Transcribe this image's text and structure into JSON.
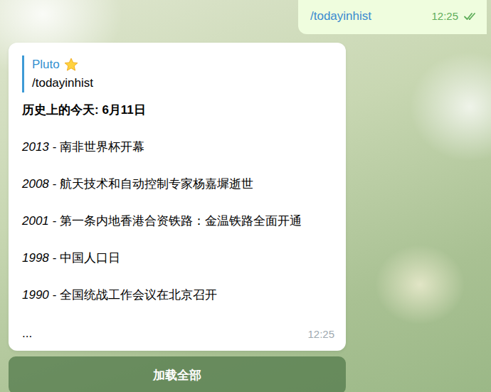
{
  "outgoing": {
    "text": "/todayinhist",
    "time": "12:25",
    "read": true
  },
  "incoming": {
    "reply": {
      "author": "Pluto",
      "text": "/todayinhist"
    },
    "title": "历史上的今天: 6月11日",
    "events": [
      {
        "year": "2013",
        "text": "- 南非世界杯开幕"
      },
      {
        "year": "2008",
        "text": "- 航天技术和自动控制专家杨嘉墀逝世"
      },
      {
        "year": "2001",
        "text": "- 第一条内地香港合资铁路：金温铁路全面开通"
      },
      {
        "year": "1998",
        "text": "- 中国人口日"
      },
      {
        "year": "1990",
        "text": "- 全国统战工作会议在北京召开"
      }
    ],
    "more": "...",
    "time": "12:25"
  },
  "inline_button": {
    "label": "加载全部"
  }
}
